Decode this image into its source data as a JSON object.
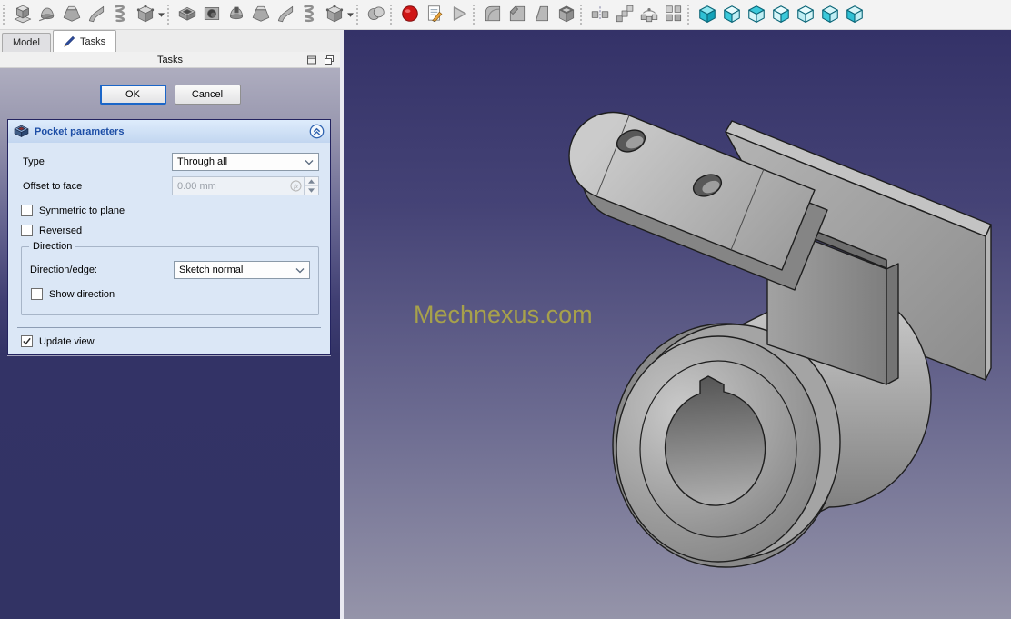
{
  "toolbar": {
    "groups": [
      {
        "name": "additive",
        "items": [
          {
            "name": "pad",
            "icon": "pad"
          },
          {
            "name": "revolution",
            "icon": "revolution"
          },
          {
            "name": "additive-loft",
            "icon": "loft"
          },
          {
            "name": "additive-pipe",
            "icon": "sweep"
          },
          {
            "name": "additive-helix",
            "icon": "helix"
          },
          {
            "name": "additive-primitive",
            "icon": "primitive",
            "dropdown": true
          }
        ]
      },
      {
        "name": "subtractive",
        "items": [
          {
            "name": "pocket",
            "icon": "pocket"
          },
          {
            "name": "hole",
            "icon": "hole"
          },
          {
            "name": "groove",
            "icon": "groove"
          },
          {
            "name": "subtractive-loft",
            "icon": "loft"
          },
          {
            "name": "subtractive-pipe",
            "icon": "sweep"
          },
          {
            "name": "subtractive-helix",
            "icon": "helix"
          },
          {
            "name": "subtractive-primitive",
            "icon": "primitive",
            "dropdown": true
          }
        ]
      },
      {
        "name": "boolean",
        "items": [
          {
            "name": "boolean-operation",
            "icon": "boolean"
          }
        ]
      },
      {
        "name": "macro",
        "items": [
          {
            "name": "macro-record",
            "icon": "record"
          },
          {
            "name": "macro-edit",
            "icon": "edit"
          },
          {
            "name": "macro-execute",
            "icon": "play"
          }
        ]
      },
      {
        "name": "dressup",
        "items": [
          {
            "name": "fillet",
            "icon": "fillet"
          },
          {
            "name": "chamfer",
            "icon": "chamfer"
          },
          {
            "name": "draft",
            "icon": "draft"
          },
          {
            "name": "thickness",
            "icon": "thickness"
          }
        ]
      },
      {
        "name": "transform",
        "items": [
          {
            "name": "mirrored",
            "icon": "mirror"
          },
          {
            "name": "linear-pattern",
            "icon": "linear"
          },
          {
            "name": "polar-pattern",
            "icon": "polar"
          },
          {
            "name": "multitransform",
            "icon": "multi"
          }
        ]
      },
      {
        "name": "views",
        "items": [
          {
            "name": "view-axonometric",
            "icon": "view-axo"
          },
          {
            "name": "view-front",
            "icon": "view-front"
          },
          {
            "name": "view-top",
            "icon": "view-top"
          },
          {
            "name": "view-right",
            "icon": "view-right"
          },
          {
            "name": "view-rear",
            "icon": "view-rear"
          },
          {
            "name": "view-bottom",
            "icon": "view-bottom"
          },
          {
            "name": "view-left",
            "icon": "view-left"
          }
        ]
      }
    ]
  },
  "tabs": [
    {
      "id": "model",
      "label": "Model",
      "active": false
    },
    {
      "id": "tasks",
      "label": "Tasks",
      "active": true
    }
  ],
  "tasks_panel": {
    "title": "Tasks",
    "buttons": {
      "ok": "OK",
      "cancel": "Cancel"
    },
    "pocket_dialog": {
      "title": "Pocket parameters",
      "type_label": "Type",
      "type_value": "Through all",
      "offset_label": "Offset to face",
      "offset_value": "0.00 mm",
      "symmetric_label": "Symmetric to plane",
      "symmetric_checked": false,
      "reversed_label": "Reversed",
      "reversed_checked": false,
      "direction_group_label": "Direction",
      "direction_edge_label": "Direction/edge:",
      "direction_edge_value": "Sketch normal",
      "show_direction_label": "Show direction",
      "show_direction_checked": false,
      "update_view_label": "Update view",
      "update_view_checked": true
    }
  },
  "viewport": {
    "watermark": "Mechnexus.com",
    "watermark_color": "#a7a14b",
    "background_top": "#343268",
    "background_bottom": "#9594a9",
    "model_gray": "#9a9a9a",
    "model_outline": "#1e1e1e"
  }
}
